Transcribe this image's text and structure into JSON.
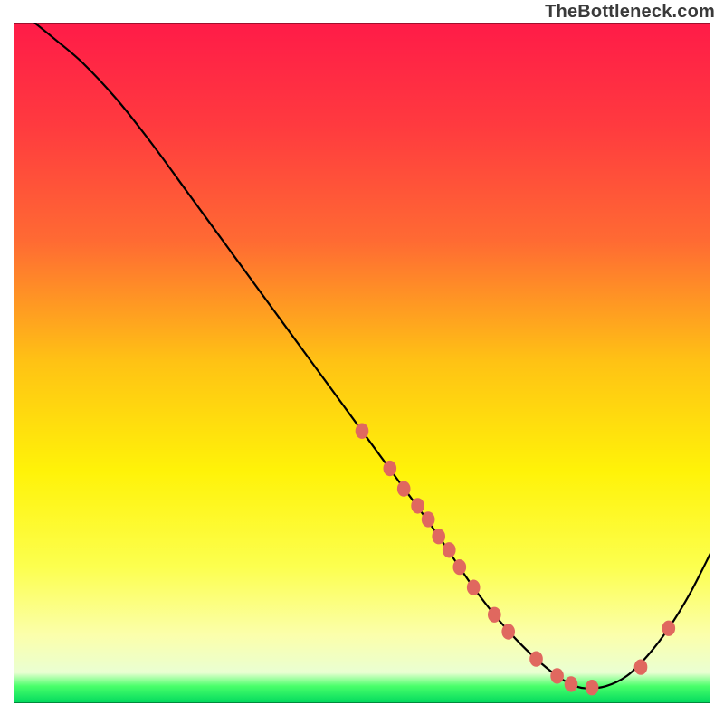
{
  "watermark": "TheBottleneck.com",
  "chart_data": {
    "type": "line",
    "title": "",
    "xlabel": "",
    "ylabel": "",
    "xlim": [
      0,
      100
    ],
    "ylim": [
      0,
      100
    ],
    "grid": false,
    "legend": false,
    "series": [
      {
        "name": "curve",
        "color": "#000000",
        "x": [
          3,
          6,
          10,
          15,
          20,
          25,
          30,
          35,
          40,
          45,
          50,
          55,
          60,
          63,
          66,
          69,
          72,
          75,
          78,
          80,
          82,
          85,
          88,
          91,
          94,
          97,
          100
        ],
        "y": [
          100,
          97.5,
          94,
          88.5,
          82,
          75,
          68,
          61,
          54,
          47,
          40,
          33,
          26,
          21.5,
          17,
          13,
          9.5,
          6.5,
          4,
          2.8,
          2.2,
          2.5,
          4,
          7,
          11,
          16,
          22
        ]
      }
    ],
    "markers": {
      "name": "dots",
      "color": "#e0685f",
      "x": [
        50,
        54,
        56,
        58,
        59.5,
        61,
        62.5,
        64,
        66,
        69,
        71,
        75,
        78,
        80,
        83,
        90,
        94
      ],
      "y": [
        40,
        34.5,
        31.5,
        29,
        27,
        24.5,
        22.5,
        20,
        17,
        13,
        10.5,
        6.5,
        4,
        2.8,
        2.3,
        5.3,
        11
      ]
    },
    "background_gradient": {
      "stops": [
        {
          "offset": 0.0,
          "color": "#ff1b48"
        },
        {
          "offset": 0.15,
          "color": "#ff3a3f"
        },
        {
          "offset": 0.32,
          "color": "#ff6a33"
        },
        {
          "offset": 0.5,
          "color": "#ffc314"
        },
        {
          "offset": 0.66,
          "color": "#fff308"
        },
        {
          "offset": 0.8,
          "color": "#fcff4f"
        },
        {
          "offset": 0.9,
          "color": "#fbffab"
        },
        {
          "offset": 0.955,
          "color": "#eaffd2"
        },
        {
          "offset": 0.975,
          "color": "#49ff6a"
        },
        {
          "offset": 1.0,
          "color": "#00d85e"
        }
      ]
    }
  }
}
